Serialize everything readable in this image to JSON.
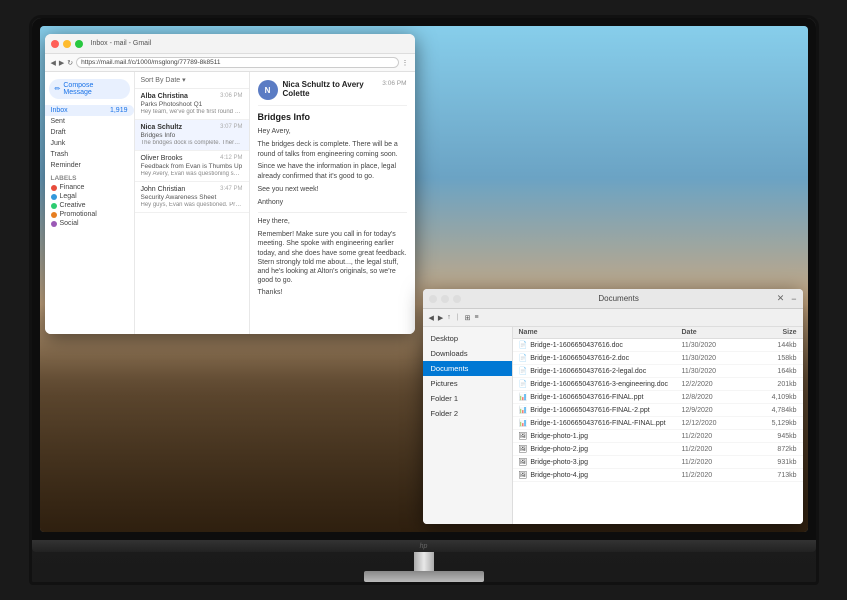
{
  "monitor": {
    "brand": "hp",
    "title_bar_text": "Inbox - mail - Gmail"
  },
  "browser": {
    "url": "https://mail.mail.f/c/1000/msglong/77789-8k8511"
  },
  "email_client": {
    "compose_label": "Compose Message",
    "sidebar": {
      "items": [
        {
          "label": "Inbox",
          "count": "1,919",
          "active": true
        },
        {
          "label": "Sent",
          "count": ""
        },
        {
          "label": "Draft",
          "count": ""
        },
        {
          "label": "Junk",
          "count": ""
        },
        {
          "label": "Trash",
          "count": ""
        },
        {
          "label": "Reminder",
          "count": ""
        }
      ],
      "labels_section": "Labels",
      "labels": [
        {
          "name": "Finance",
          "color": "#e74c3c"
        },
        {
          "name": "Legal",
          "color": "#3498db"
        },
        {
          "name": "Creative",
          "color": "#2ecc71"
        },
        {
          "name": "Promotional",
          "color": "#e67e22"
        },
        {
          "name": "Social",
          "color": "#9b59b6"
        }
      ]
    },
    "email_list": {
      "sort_label": "Sort By Date",
      "emails": [
        {
          "sender": "Alba Christina",
          "subject": "Parks Photoshoot Q1",
          "preview": "Hey team, we've got the first round of drone shots to check out. Please let me know your...",
          "time": "3:06 PM",
          "unread": true
        },
        {
          "sender": "Nica Schultz",
          "subject": "Bridges Info",
          "preview": "The bridges dock is complete. There will be a round of talks from engineering coming soon...",
          "time": "3:07 PM",
          "unread": false
        },
        {
          "sender": "Oliver Brooks",
          "subject": "Feedback from Evan is Thumbs Up",
          "preview": "Hey Avery, Evan was questioning some of the shots, but we got our mgmt to proceed with initiative...",
          "time": "4:12 PM",
          "unread": false
        },
        {
          "sender": "John Christian",
          "subject": "Security Awareness Sheet",
          "preview": "Hey guys, Evan was questioned. Print before we meeting this afternoon.",
          "time": "3:47 PM",
          "unread": false
        }
      ]
    },
    "email_content": {
      "from_name": "Nica Schultz",
      "from_to": "Nica Schultz to Avery Colette",
      "time": "3:06 PM",
      "subject": "Bridges Info",
      "greeting": "Hey Avery,",
      "body_lines": [
        "The bridges deck is complete. There will be a round of talks from engineering coming soon.",
        "",
        "Since we have the information in place, legal already confirmed that it's good to go.",
        "",
        "See you next week!",
        "",
        "Anthony"
      ],
      "second_email_from": "Hey there,",
      "second_body": "Remember! Make sure you call in for today's meeting. She spoke with engineering earlier today, and she does have some great feedback. Stern strongly told me about..., the legal stuff, and he's looking at Alton's originals, so we're good to go.",
      "second_sign": "Thanks!"
    }
  },
  "file_explorer": {
    "title": "Documents",
    "toolbar_icons": [
      "←",
      "→",
      "↑"
    ],
    "sidebar_items": [
      {
        "label": "Desktop",
        "active": false
      },
      {
        "label": "Downloads",
        "active": false
      },
      {
        "label": "Documents",
        "active": true
      },
      {
        "label": "Pictures",
        "active": false
      },
      {
        "label": "Folder 1",
        "active": false
      },
      {
        "label": "Folder 2",
        "active": false
      }
    ],
    "columns": [
      "Name",
      "Date",
      "Size"
    ],
    "files": [
      {
        "name": "Bridge-1-1606650437616.doc",
        "date": "11/30/2020",
        "size": "144kb",
        "icon": "📄"
      },
      {
        "name": "Bridge-1-1606650437616-2.doc",
        "date": "11/30/2020",
        "size": "158kb",
        "icon": "📄"
      },
      {
        "name": "Bridge-1-1606650437616-2-legal.doc",
        "date": "11/30/2020",
        "size": "164kb",
        "icon": "📄"
      },
      {
        "name": "Bridge-1-1606650437616-3-engineering.doc",
        "date": "12/2/2020",
        "size": "201kb",
        "icon": "📄"
      },
      {
        "name": "Bridge-1-1606650437616-FINAL.ppt",
        "date": "12/8/2020",
        "size": "4,109kb",
        "icon": "📊"
      },
      {
        "name": "Bridge-1-1606650437616-FINAL-2.ppt",
        "date": "12/9/2020",
        "size": "4,784kb",
        "icon": "📊"
      },
      {
        "name": "Bridge-1-1606650437616-FINAL-FINAL.ppt",
        "date": "12/12/2020",
        "size": "5,129kb",
        "icon": "📊"
      },
      {
        "name": "Bridge-photo-1.jpg",
        "date": "11/2/2020",
        "size": "945kb",
        "icon": "🖼"
      },
      {
        "name": "Bridge-photo-2.jpg",
        "date": "11/2/2020",
        "size": "872kb",
        "icon": "🖼"
      },
      {
        "name": "Bridge-photo-3.jpg",
        "date": "11/2/2020",
        "size": "931kb",
        "icon": "🖼"
      },
      {
        "name": "Bridge-photo-4.jpg",
        "date": "11/2/2020",
        "size": "713kb",
        "icon": "🖼"
      }
    ]
  }
}
